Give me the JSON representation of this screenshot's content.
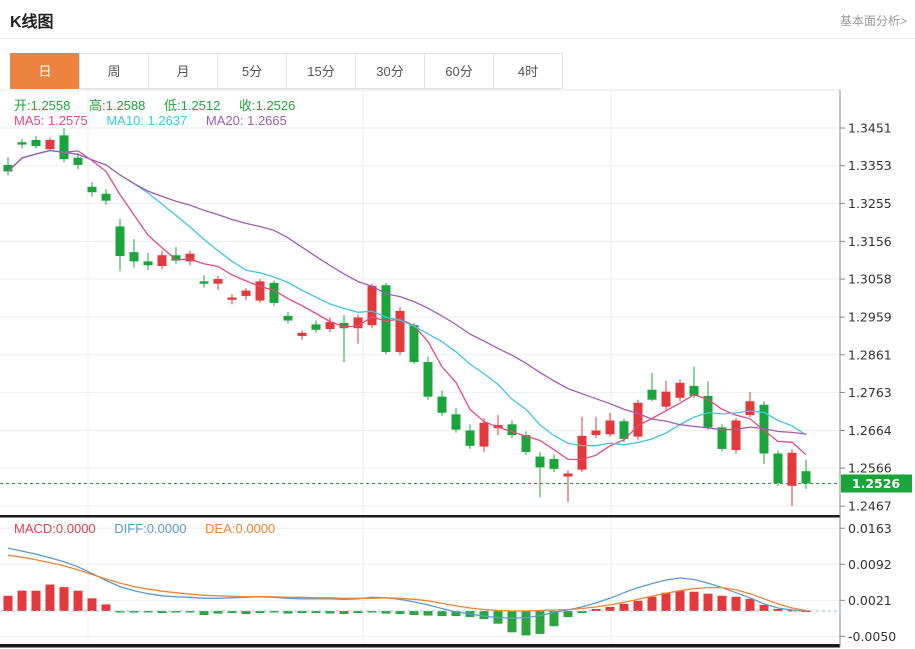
{
  "header": {
    "title": "K线图",
    "link": "基本面分析>"
  },
  "tabs": [
    {
      "label": "日",
      "active": true
    },
    {
      "label": "周",
      "active": false
    },
    {
      "label": "月",
      "active": false
    },
    {
      "label": "5分",
      "active": false
    },
    {
      "label": "15分",
      "active": false
    },
    {
      "label": "30分",
      "active": false
    },
    {
      "label": "60分",
      "active": false
    },
    {
      "label": "4时",
      "active": false
    }
  ],
  "legend": {
    "ohlc": [
      {
        "text": "开:1.2558"
      },
      {
        "text": "高:1.2588"
      },
      {
        "text": "低:1.2512"
      },
      {
        "text": "收:1.2526"
      }
    ],
    "ma": [
      {
        "text": "MA5: 1.2575"
      },
      {
        "text": "MA10: 1.2637"
      },
      {
        "text": "MA20: 1.2665"
      }
    ],
    "macd": [
      {
        "text": "MACD:0.0000"
      },
      {
        "text": "DIFF:0.0000"
      },
      {
        "text": "DEA:0.0000"
      }
    ]
  },
  "chart_data": {
    "type": "candlestick",
    "title": "K线图 (daily K-line with MA5/MA10/MA20 and MACD sub-chart)",
    "legend_position": "top-left",
    "grid": true,
    "price_panel": {
      "y_axis_ticks": [
        1.3451,
        1.3353,
        1.3255,
        1.3156,
        1.3058,
        1.2959,
        1.2861,
        1.2763,
        1.2664,
        1.2566,
        1.2467
      ],
      "ylim": [
        1.2444,
        1.355
      ],
      "last_price": 1.2526,
      "last_candle": {
        "open": 1.2558,
        "high": 1.2588,
        "low": 1.2512,
        "close": 1.2526
      },
      "ma_values": {
        "MA5": 1.2575,
        "MA10": 1.2637,
        "MA20": 1.2665
      },
      "up_color": "#e23a3c",
      "down_color": "#1ca43c",
      "last_price_line_color": "#1ca43c",
      "ma": [
        {
          "name": "MA5",
          "period": 5,
          "color": "#e8497f"
        },
        {
          "name": "MA10",
          "period": 10,
          "color": "#3ec6e8"
        },
        {
          "name": "MA20",
          "period": 20,
          "color": "#a35cb5"
        }
      ],
      "candles": [
        [
          1.3355,
          1.3375,
          1.3328,
          1.3338
        ],
        [
          1.3414,
          1.3422,
          1.3398,
          1.3408
        ],
        [
          1.342,
          1.343,
          1.3398,
          1.3404
        ],
        [
          1.3396,
          1.3426,
          1.339,
          1.342
        ],
        [
          1.3432,
          1.3451,
          1.3362,
          1.337
        ],
        [
          1.3374,
          1.3386,
          1.3344,
          1.3355
        ],
        [
          1.3298,
          1.331,
          1.3272,
          1.3284
        ],
        [
          1.328,
          1.3292,
          1.3252,
          1.3262
        ],
        [
          1.3195,
          1.3215,
          1.3078,
          1.3118
        ],
        [
          1.3128,
          1.3162,
          1.3088,
          1.3104
        ],
        [
          1.3104,
          1.3126,
          1.3082,
          1.3094
        ],
        [
          1.3092,
          1.3132,
          1.3084,
          1.312
        ],
        [
          1.312,
          1.3142,
          1.3098,
          1.3106
        ],
        [
          1.3104,
          1.3132,
          1.3094,
          1.3124
        ],
        [
          1.3052,
          1.3068,
          1.3036,
          1.3046
        ],
        [
          1.3046,
          1.3066,
          1.303,
          1.3058
        ],
        [
          1.3004,
          1.3018,
          1.2992,
          1.301
        ],
        [
          1.3014,
          1.3034,
          1.3004,
          1.3028
        ],
        [
          1.3002,
          1.3058,
          1.2996,
          1.3052
        ],
        [
          1.3048,
          1.3054,
          1.2988,
          1.2996
        ],
        [
          1.2962,
          1.2972,
          1.2942,
          1.295
        ],
        [
          1.291,
          1.2924,
          1.29,
          1.2918
        ],
        [
          1.294,
          1.295,
          1.2918,
          1.2926
        ],
        [
          1.2928,
          1.2958,
          1.292,
          1.2946
        ],
        [
          1.2944,
          1.2964,
          1.2842,
          1.293
        ],
        [
          1.293,
          1.2966,
          1.289,
          1.2958
        ],
        [
          1.2938,
          1.3046,
          1.293,
          1.304
        ],
        [
          1.3042,
          1.3048,
          1.2862,
          1.2868
        ],
        [
          1.2868,
          1.2985,
          1.286,
          1.2975
        ],
        [
          1.2938,
          1.2944,
          1.2836,
          1.2842
        ],
        [
          1.2842,
          1.2856,
          1.2744,
          1.2752
        ],
        [
          1.2752,
          1.2768,
          1.2702,
          1.271
        ],
        [
          1.2706,
          1.2722,
          1.2658,
          1.2666
        ],
        [
          1.2664,
          1.268,
          1.2616,
          1.2624
        ],
        [
          1.2622,
          1.2696,
          1.2608,
          1.2684
        ],
        [
          1.267,
          1.2704,
          1.2652,
          1.2678
        ],
        [
          1.268,
          1.269,
          1.2644,
          1.2652
        ],
        [
          1.2652,
          1.2662,
          1.26,
          1.2608
        ],
        [
          1.2596,
          1.2608,
          1.249,
          1.2568
        ],
        [
          1.259,
          1.2602,
          1.2556,
          1.2564
        ],
        [
          1.2544,
          1.256,
          1.2478,
          1.2552
        ],
        [
          1.2562,
          1.27,
          1.2556,
          1.265
        ],
        [
          1.2652,
          1.27,
          1.2644,
          1.2664
        ],
        [
          1.2654,
          1.271,
          1.2648,
          1.269
        ],
        [
          1.2688,
          1.2694,
          1.2634,
          1.2642
        ],
        [
          1.2648,
          1.2744,
          1.264,
          1.2736
        ],
        [
          1.277,
          1.2814,
          1.274,
          1.2744
        ],
        [
          1.2726,
          1.2793,
          1.2718,
          1.2765
        ],
        [
          1.2749,
          1.2796,
          1.274,
          1.2788
        ],
        [
          1.278,
          1.283,
          1.2748,
          1.2754
        ],
        [
          1.2754,
          1.2792,
          1.2666,
          1.2672
        ],
        [
          1.2672,
          1.268,
          1.261,
          1.2616
        ],
        [
          1.2613,
          1.2696,
          1.2604,
          1.269
        ],
        [
          1.2704,
          1.2764,
          1.2698,
          1.274
        ],
        [
          1.2731,
          1.274,
          1.2577,
          1.2604
        ],
        [
          1.2604,
          1.2612,
          1.252,
          1.2527
        ],
        [
          1.252,
          1.2615,
          1.2467,
          1.2606
        ],
        [
          1.2558,
          1.2588,
          1.2512,
          1.2526
        ]
      ]
    },
    "macd_panel": {
      "y_axis_ticks": [
        0.0163,
        0.0092,
        0.0021,
        -0.005
      ],
      "macd": 0.0,
      "diff": 0.0,
      "dea": 0.0,
      "unit": 0.0001,
      "hist_up_color": "#e23a3c",
      "hist_down_color": "#2ca53c",
      "diff_color": "#5b9bd5",
      "dea_color": "#f08433",
      "zero_line_color": "#8ec6e8",
      "hist": [
        30,
        40,
        40,
        52,
        47,
        40,
        25,
        13,
        -2,
        -3,
        -3,
        -4,
        -3,
        -3,
        -8,
        -5,
        -4,
        -6,
        -4,
        -3,
        -5,
        -4,
        -4,
        -5,
        -6,
        -4,
        -3,
        -5,
        -6,
        -8,
        -9,
        -10,
        -10,
        -12,
        -16,
        -25,
        -42,
        -48,
        -45,
        -30,
        -12,
        -4,
        4,
        8,
        14,
        20,
        28,
        36,
        40,
        38,
        34,
        30,
        28,
        24,
        12,
        4,
        2,
        1
      ],
      "diff_line": [
        124,
        118,
        112,
        105,
        97,
        87,
        74,
        60,
        48,
        40,
        34,
        30,
        28,
        27,
        25,
        25,
        26,
        27,
        28,
        27,
        25,
        24,
        24,
        24,
        23,
        24,
        27,
        26,
        23,
        18,
        12,
        5,
        -2,
        -6,
        -10,
        -13,
        -14,
        -13,
        -9,
        -3,
        2,
        8,
        16,
        25,
        36,
        46,
        54,
        61,
        65,
        62,
        55,
        46,
        36,
        26,
        14,
        6,
        2,
        0
      ],
      "dea_line": [
        110,
        106,
        101,
        95,
        89,
        81,
        72,
        63,
        55,
        48,
        43,
        39,
        36,
        33,
        31,
        30,
        29,
        28,
        28,
        28,
        27,
        27,
        26,
        26,
        25,
        25,
        25,
        26,
        25,
        23,
        20,
        15,
        10,
        6,
        3,
        1,
        0,
        0,
        1,
        2,
        3,
        5,
        8,
        12,
        17,
        23,
        29,
        35,
        40,
        44,
        46,
        46,
        42,
        34,
        24,
        14,
        6,
        1
      ]
    }
  }
}
